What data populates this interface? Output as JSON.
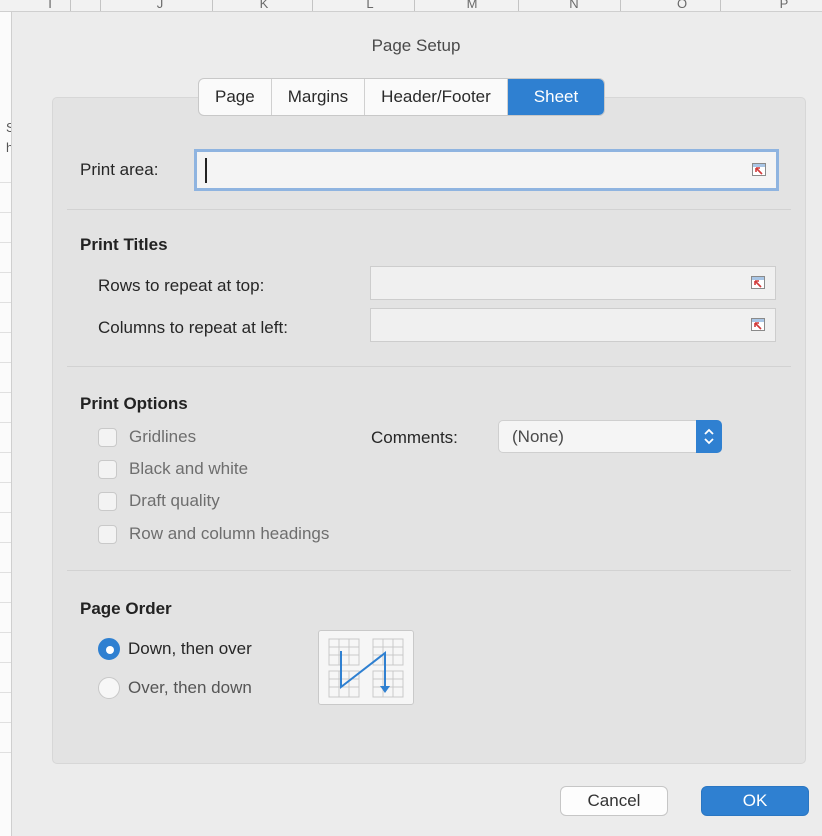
{
  "spreadsheet": {
    "column_letters": [
      "I",
      "J",
      "K",
      "L",
      "M",
      "N",
      "O",
      "P"
    ]
  },
  "dialog": {
    "title": "Page Setup",
    "tabs": [
      {
        "label": "Page",
        "active": false
      },
      {
        "label": "Margins",
        "active": false
      },
      {
        "label": "Header/Footer",
        "active": false
      },
      {
        "label": "Sheet",
        "active": true
      }
    ]
  },
  "print_area": {
    "label": "Print area:",
    "value": ""
  },
  "print_titles": {
    "heading": "Print Titles",
    "rows_label": "Rows to repeat at top:",
    "rows_value": "",
    "columns_label": "Columns to repeat at left:",
    "columns_value": ""
  },
  "print_options": {
    "heading": "Print Options",
    "checkboxes": [
      {
        "label": "Gridlines",
        "checked": false
      },
      {
        "label": "Black and white",
        "checked": false
      },
      {
        "label": "Draft quality",
        "checked": false
      },
      {
        "label": "Row and column headings",
        "checked": false
      }
    ],
    "comments_label": "Comments:",
    "comments_value": "(None)"
  },
  "page_order": {
    "heading": "Page Order",
    "options": [
      {
        "label": "Down, then over",
        "selected": true
      },
      {
        "label": "Over, then down",
        "selected": false
      }
    ]
  },
  "buttons": {
    "cancel": "Cancel",
    "ok": "OK"
  },
  "colors": {
    "accent": "#2f80d1",
    "focus_ring": "#8fb4e0",
    "dialog_bg": "#ececec",
    "panel_bg": "#e3e3e3"
  },
  "icons": {
    "range_picker": "collapse-dialog-range-icon",
    "select_arrows": "up-down-chevron-icon",
    "page_order_preview": "page-order-down-then-over-icon"
  }
}
